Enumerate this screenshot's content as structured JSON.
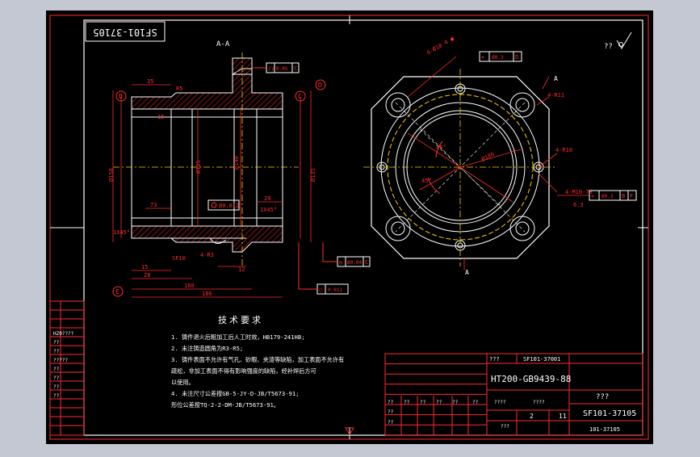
{
  "section_label": "A-A",
  "stamp_code": "SF101-37105",
  "roughness_top_right": "??",
  "tech_requirements": {
    "heading": "技术要求",
    "items": [
      "1. 铸件退火后粗加工后人工时效，HB179-241HB;",
      "2. 未注铸造圆角为R3-R5;",
      "3. 铸件表面不允许有气孔、砂眼、夹渣等缺陷，加工表面不允许有",
      "   疏松，非加工表面不得有影响强度的缺陷，经补焊后方可",
      "   以使用。",
      "4. 未注尺寸公差按GB-5-JY-D-JB/T5673-91;",
      "   形位公差按TQ-2-2-DM-JB/T5673-91。"
    ]
  },
  "dims": {
    "d35": "35",
    "r5": "R5",
    "d73": "73",
    "d20": "20",
    "d15": "15",
    "d12": "12",
    "d28": "28",
    "d186": "186",
    "d160": "160",
    "dia_bore": "Ø125",
    "dia_outer": "Ø150",
    "dia_a": "Ø140",
    "dia_b": "Ø135",
    "chamfer1": "1X45°",
    "chamfer2": "1X45°",
    "sf10": "SF10",
    "r3": "4-R3",
    "r16": "16",
    "dim_0012": "Ø0.012",
    "a45": "45°",
    "a45b": "45°",
    "dia_pcd": "Ø186",
    "holes": "4-Ø18 4 ●",
    "r11": "4-R11",
    "r10": "4-R10",
    "m10": "4-M10-7H",
    "m10_sub": "6.3"
  },
  "datums": {
    "b": "B",
    "c": "C",
    "d": "D",
    "e": "E",
    "a": "A"
  },
  "fcf": {
    "top": {
      "sym": "//",
      "val": "0.05",
      "ref": "C"
    },
    "top_right": {
      "sym": "⌖",
      "val": "Ø0.3",
      "ref": "D"
    },
    "right": {
      "sym": "⌖",
      "val": "Ø0.3",
      "ref1": "B",
      "ref2": "F"
    },
    "bottom": {
      "sym": "◎",
      "val": "Ø0.04",
      "ref": "C"
    },
    "bottom2": {
      "sym": "○",
      "val": "0.011"
    }
  },
  "title_block": {
    "material": "HT200-GB9439-88",
    "ref_code_top": "SF101-37001",
    "code": "SF101-37105",
    "code_small": "101-37105",
    "unknown": "???",
    "qmark3": "???",
    "scale": "2",
    "sheet": "11",
    "placeholders": [
      "??",
      "??",
      "??",
      "??",
      "??",
      "??",
      "??",
      "??",
      "???",
      "????",
      "????"
    ]
  },
  "left_strip": [
    "HZ0????",
    "??",
    "??",
    "?????",
    "??",
    "??",
    "??",
    "??"
  ]
}
